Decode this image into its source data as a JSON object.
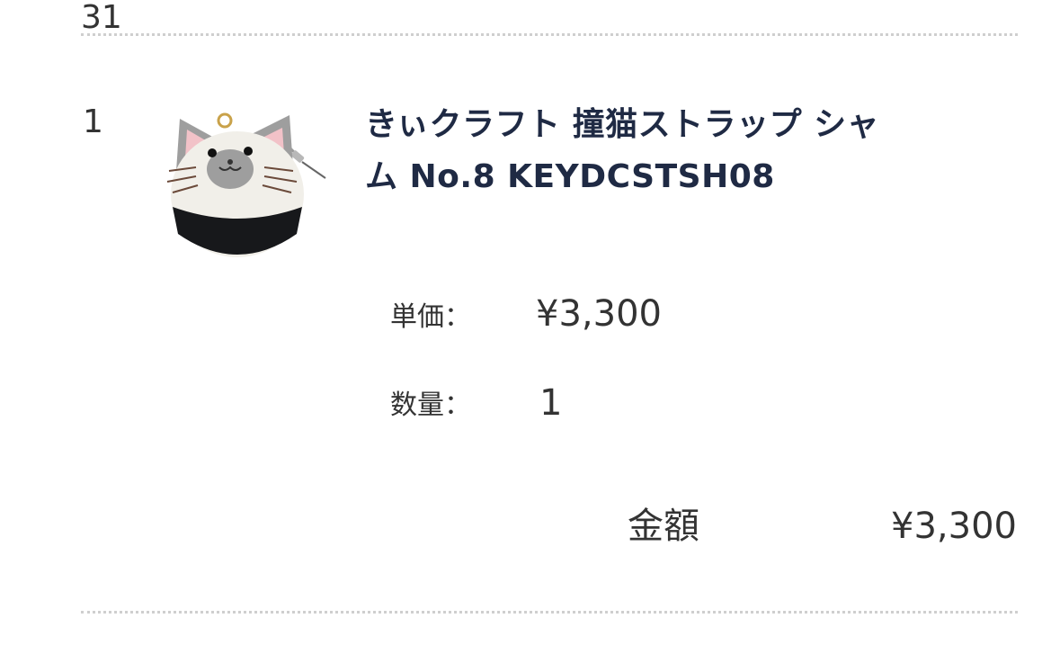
{
  "previous_item": {
    "number": "31"
  },
  "item": {
    "index": "1",
    "title_line1": "きぃクラフト 撞猫ストラップ シャ",
    "title_line2": "ム No.8 KEYDCSTSH08",
    "unit_price_label": "単価：",
    "unit_price": "¥3,300",
    "quantity_label": "数量：",
    "quantity": "1",
    "image_icon": "felt-cat-strap-image"
  },
  "summary": {
    "amount_label": "金額",
    "amount_value": "¥3,300"
  },
  "colors": {
    "title": "#1f2a44",
    "text": "#333333",
    "divider": "#cfcfcf"
  }
}
